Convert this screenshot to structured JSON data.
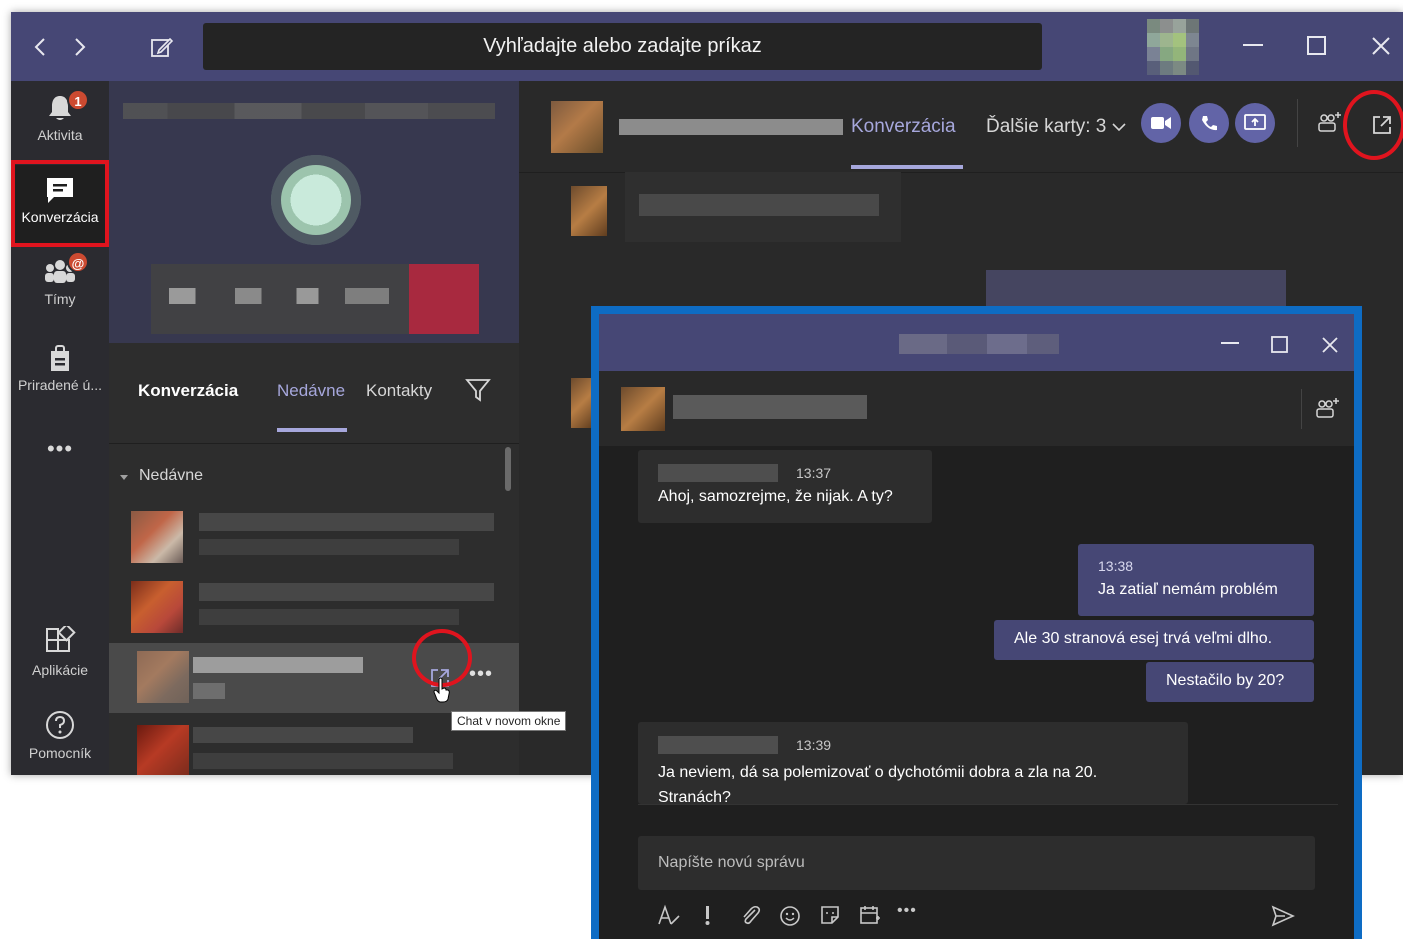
{
  "titlebar": {
    "back_icon": "chevron-left-icon",
    "forward_icon": "chevron-right-icon",
    "compose_icon": "compose-icon",
    "search_text": "Vyhľadajte alebo zadajte príkaz"
  },
  "rail": {
    "items": [
      {
        "label": "Aktivita",
        "icon": "bell-icon",
        "badge": "1"
      },
      {
        "label": "Konverzácia",
        "icon": "chat-icon"
      },
      {
        "label": "Tímy",
        "icon": "teams-icon",
        "badge": "@"
      },
      {
        "label": "Priradené ú...",
        "icon": "assignments-icon"
      },
      {
        "label": "•••",
        "icon": "more-icon"
      },
      {
        "label": "Aplikácie",
        "icon": "apps-icon"
      },
      {
        "label": "Pomocník",
        "icon": "help-icon"
      }
    ]
  },
  "list": {
    "title": "Konverzácia",
    "tabs": [
      "Nedávne",
      "Kontakty"
    ],
    "filter_icon": "filter-icon",
    "section": "Nedávne",
    "popout_icon": "popout-icon",
    "more_icon": "ellipsis-icon",
    "tooltip": "Chat v novom okne"
  },
  "conversation": {
    "tab": "Konverzácia",
    "more_tabs": "Ďalšie karty: 3",
    "video_icon": "video-call-icon",
    "call_icon": "audio-call-icon",
    "share_icon": "share-screen-icon",
    "add_people_icon": "add-people-icon",
    "popout_icon": "popout-icon"
  },
  "popup": {
    "minimize_icon": "minimize-icon",
    "maximize_icon": "maximize-icon",
    "close_icon": "close-icon",
    "messages": [
      {
        "time": "13:37",
        "text": "Ahoj, samozrejme, že nijak. A ty?"
      },
      {
        "time": "13:38",
        "text": "Ja zatiaľ nemám problém"
      },
      {
        "time": "",
        "text": "Ale 30 stranová esej trvá veľmi dlho."
      },
      {
        "time": "",
        "text": "Nestačilo by 20?"
      },
      {
        "time": "13:39",
        "text": "Ja neviem, dá sa polemizovať o dychotómii dobra a zla na 20. Stranách?"
      }
    ],
    "compose_placeholder": "Napíšte novú správu",
    "format_icons": [
      "format-icon",
      "important-icon",
      "attach-icon",
      "emoji-icon",
      "sticker-icon",
      "schedule-icon",
      "more-icon"
    ],
    "send_icon": "send-icon"
  },
  "colors": {
    "titlebar": "#464775",
    "accent": "#a6a7dc",
    "brand": "#6264a7",
    "annotation": "#e0141e",
    "popup_border": "#0e6cc4"
  }
}
